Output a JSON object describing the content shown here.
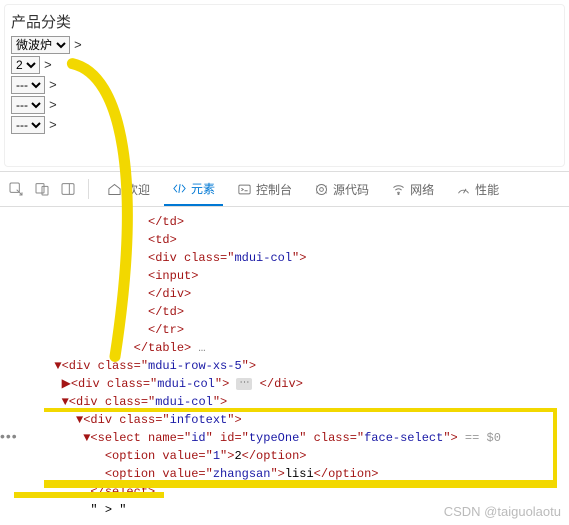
{
  "page": {
    "title": "产品分类",
    "selects": [
      {
        "value": "微波炉",
        "sep": ">"
      },
      {
        "value": "2",
        "sep": ">"
      },
      {
        "value": "---",
        "sep": ">"
      },
      {
        "value": "---",
        "sep": ">"
      },
      {
        "value": "---",
        "sep": ">"
      }
    ]
  },
  "devtools": {
    "tabs": {
      "welcome": "欢迎",
      "elements": "元素",
      "console": "控制台",
      "sources": "源代码",
      "network": "网络",
      "performance": "性能"
    },
    "dom_lines": {
      "l0": "                    </td>",
      "l1": "",
      "l2": "                    <td>",
      "l3a": "                    <div class=\"",
      "l3b": "mdui-col",
      "l3c": "\">",
      "l4": "                    <input>",
      "l5": "                    </div>",
      "l6": "                    </td>",
      "l7": "                    </tr>",
      "l8": "                  </table>",
      "l8e": " … ",
      "l9a": "       ▼<div class=\"",
      "l9b": "mdui-row-xs-5",
      "l9c": "\">",
      "l10a": "        ▶<div class=\"",
      "l10b": "mdui-col",
      "l10c": "\"> ",
      "l10d": " </div>",
      "l11a": "        ▼<div class=\"",
      "l11b": "mdui-col",
      "l11c": "\">",
      "l12a": "          ▼<div class=\"",
      "l12b": "infotext",
      "l12c": "\">",
      "l13a": "           ▼<select name=\"",
      "l13b": "id",
      "l13c": "\" id=\"",
      "l13d": "typeOne",
      "l13e": "\" class=\"",
      "l13f": "face-select",
      "l13g": "\">",
      "l13eq": " == $0",
      "l14a": "              <option value=\"",
      "l14b": "1",
      "l14c": "\">",
      "l14d": "2",
      "l14e": "</option>",
      "l15a": "              <option value=\"",
      "l15b": "zhangsan",
      "l15c": "\">",
      "l15d": "lisi",
      "l15e": "</option>",
      "l16": "            </select>",
      "l17": "            \" > \""
    }
  },
  "watermark": "CSDN @taiguolaotu",
  "ellipsis_glyph": "⋯"
}
